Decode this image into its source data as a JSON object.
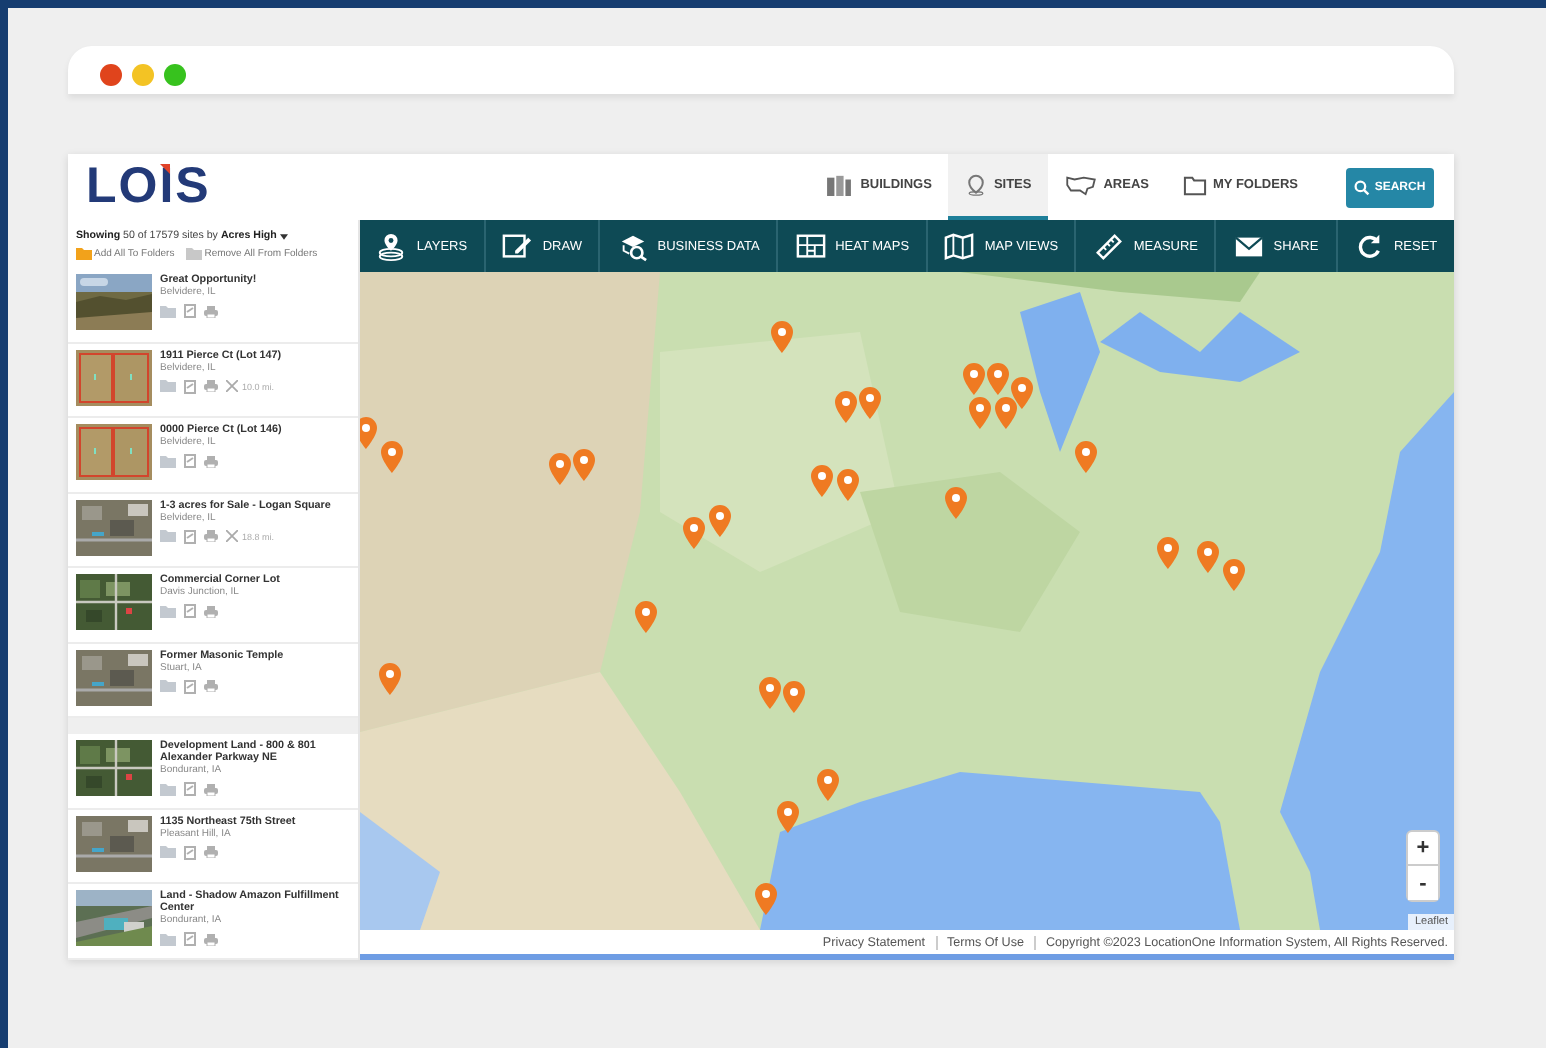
{
  "window_controls": [
    {
      "color": "#e0441c"
    },
    {
      "color": "#f3c324"
    },
    {
      "color": "#37c21e"
    }
  ],
  "logo": "LOIS",
  "nav": [
    {
      "label": "BUILDINGS",
      "selected": false
    },
    {
      "label": "SITES",
      "selected": true
    },
    {
      "label": "AREAS",
      "selected": false
    },
    {
      "label": "MY FOLDERS",
      "selected": false
    }
  ],
  "search_button": "SEARCH",
  "sidebar": {
    "summary": "**Showing** 50 of 17579 sites by **Acres High**",
    "actions": [
      {
        "label": "Add All To Folders",
        "kind": "add"
      },
      {
        "label": "Remove All From Folders",
        "kind": "remove"
      }
    ],
    "items": [
      {
        "title": "Great Opportunity!",
        "location": "Belvidere, IL"
      },
      {
        "title": "1911 Pierce Ct (Lot 147)",
        "location": "Belvidere, IL",
        "distance": "10.0 mi."
      },
      {
        "title": "0000 Pierce Ct (Lot 146)",
        "location": "Belvidere, IL"
      },
      {
        "title": "1-3 acres for Sale - Logan Square",
        "location": "Belvidere, IL",
        "distance": "18.8 mi."
      },
      {
        "title": "Commercial Corner Lot",
        "location": "Davis Junction, IL"
      },
      {
        "title": "Former Masonic Temple",
        "location": "Stuart, IA"
      },
      {
        "title": "Development Land - 800 & 801 Alexander Parkway NE",
        "location": "Bondurant, IA"
      },
      {
        "title": "1135 Northeast 75th Street",
        "location": "Pleasant Hill, IA"
      },
      {
        "title": "Land - Shadow Amazon Fulfillment Center",
        "location": "Bondurant, IA"
      }
    ]
  },
  "toolbar": [
    "LAYERS",
    "DRAW",
    "BUSINESS DATA",
    "HEAT MAPS",
    "MAP VIEWS",
    "MEASURE",
    "SHARE",
    "RESET"
  ],
  "map": {
    "zoom_in": "+",
    "zoom_out": "-",
    "attribution": "Leaflet"
  },
  "footer": {
    "links": [
      "Privacy Statement",
      "Terms Of Use"
    ],
    "copyright": "Copyright ©2023 LocationOne Information System, All Rights Reserved."
  }
}
